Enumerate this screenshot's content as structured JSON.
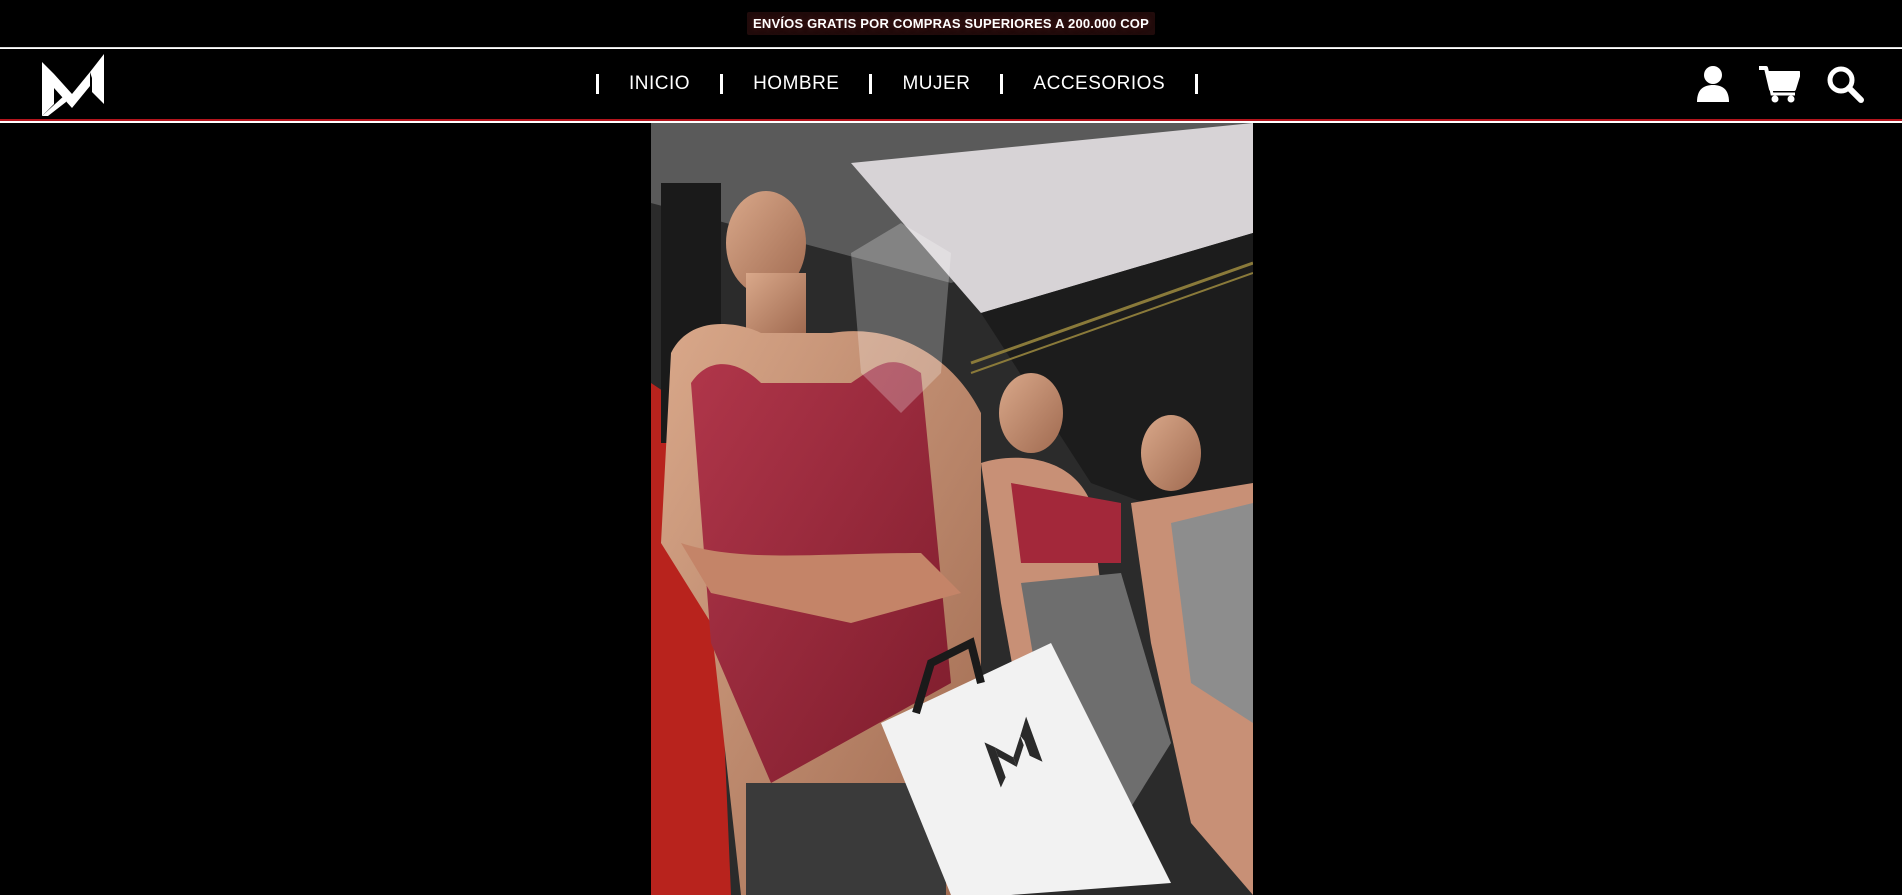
{
  "announcement": {
    "text": "ENVÍOS GRATIS POR COMPRAS SUPERIORES A 200.000 COP"
  },
  "header": {
    "logo_icon": "wm-brand-logo",
    "nav": [
      {
        "label": "INICIO"
      },
      {
        "label": "HOMBRE"
      },
      {
        "label": "MUJER"
      },
      {
        "label": "ACCESORIOS"
      }
    ],
    "icons": [
      "user-icon",
      "cart-icon",
      "search-icon"
    ]
  },
  "hero": {
    "media": "gym-models-promo-video",
    "bag_logo_icon": "wm-brand-logo"
  },
  "colors": {
    "background": "#000000",
    "accent_line": "#b3141c",
    "text": "#ffffff",
    "shirt": "#9b2335"
  }
}
